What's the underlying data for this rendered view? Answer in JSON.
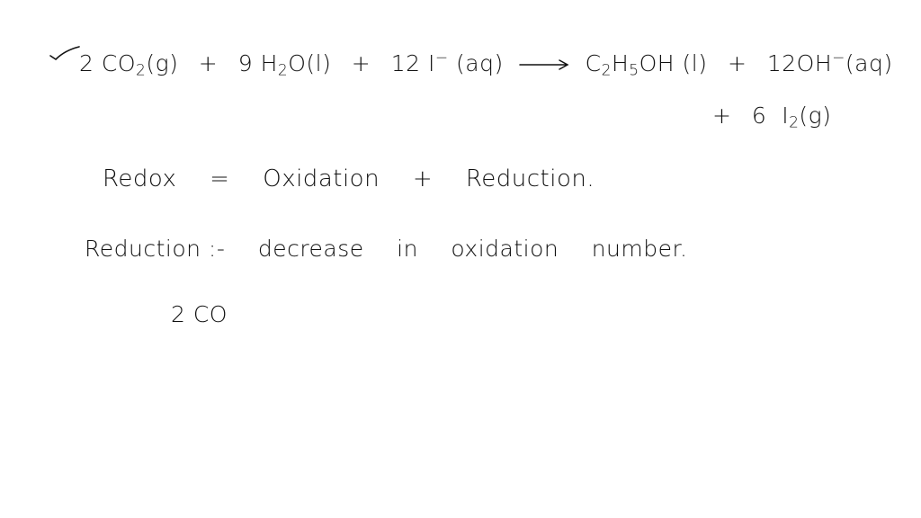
{
  "board": {
    "background": "#ffffff",
    "ink_color": "#111111"
  },
  "equation": {
    "mark_icon": "checkmark-icon",
    "reactants": [
      {
        "coefficient": "2",
        "formula": "CO",
        "subscript": "2",
        "state": "(g)"
      },
      {
        "coefficient": "9",
        "formula": "H",
        "subscript": "2",
        "formula_tail": "O",
        "state": "(l)"
      },
      {
        "coefficient": "12",
        "formula": "I",
        "charge": "−",
        "state": "(aq)"
      }
    ],
    "plus": "+",
    "arrow_icon": "right-arrow-icon",
    "products": [
      {
        "formula": "C",
        "subscript": "2",
        "formula_tail": "H",
        "subscript2": "5",
        "formula_tail2": "OH",
        "state": "(l)"
      },
      {
        "coefficient": "12",
        "formula": "OH",
        "charge": "−",
        "state": "(aq)"
      },
      {
        "coefficient": "6",
        "formula": "I",
        "subscript": "2",
        "state": "(g)"
      }
    ]
  },
  "definition": {
    "term": "Redox",
    "equals": "=",
    "part1": "Oxidation",
    "plus": "+",
    "part2": "Reduction."
  },
  "reduction_note": {
    "label": "Reduction :-",
    "text_words": [
      "decrease",
      "in",
      "oxidation",
      "number."
    ]
  },
  "work": {
    "partial": "2 CO"
  }
}
